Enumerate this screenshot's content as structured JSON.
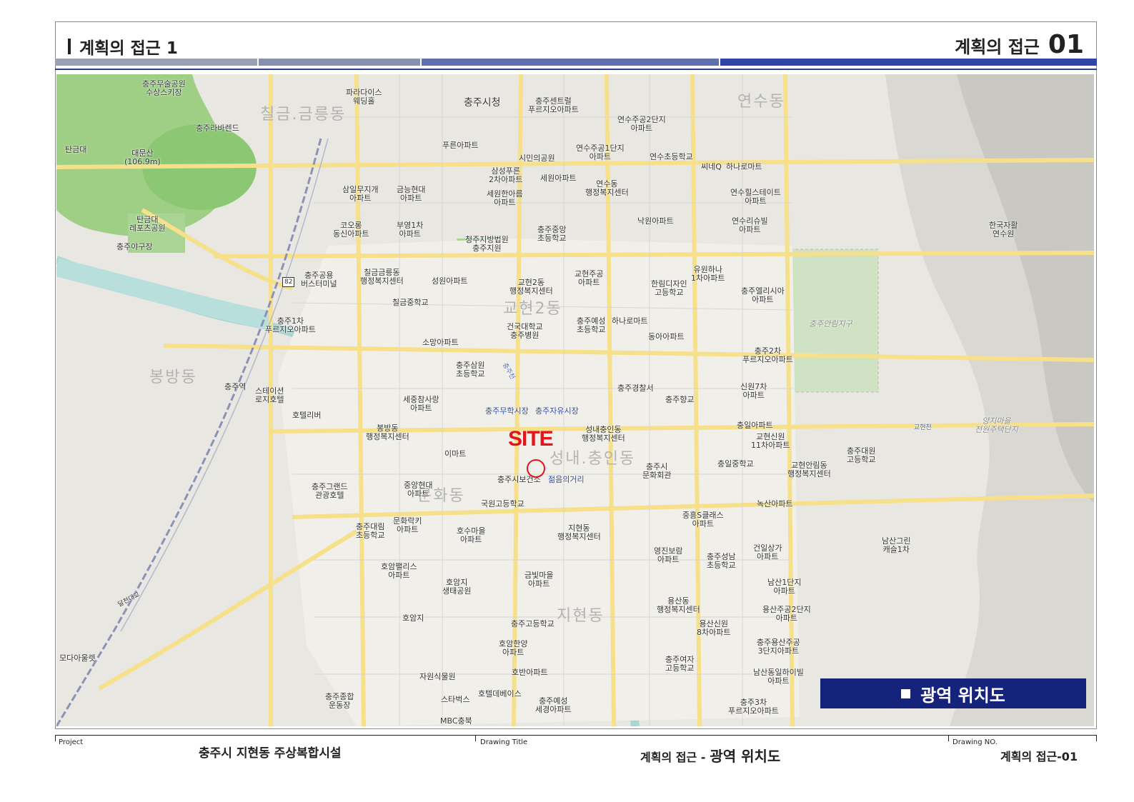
{
  "header": {
    "left_title": "계획의 접근 1",
    "right_title": "계획의 접근",
    "right_number": "01"
  },
  "colors": {
    "stripe_1": "#9aa1b5",
    "stripe_2": "#8790ac",
    "stripe_3": "#5e70ad",
    "stripe_4": "#3046a6",
    "site_red": "#e3141c",
    "legend_navy": "#16237a"
  },
  "map": {
    "site_label": "SITE",
    "legend_label": "광역 위치도",
    "districts": [
      "칠금.금릉동",
      "연수동",
      "교현2동",
      "봉방동",
      "성내.충인동",
      "지현동",
      "문화동"
    ],
    "places": [
      "충주무술공원\n수상스키장",
      "파라다이스\n웨딩홀",
      "충주시청",
      "충주센트럴\n푸르지오아파트",
      "연수주공2단지\n아파트",
      "충주라바렌드",
      "탄금대",
      "대문산\n(106.9m)",
      "푸른아파트",
      "시민의공원",
      "연수주공1단지\n아파트",
      "연수초등학교",
      "씨네Q",
      "하나로마트",
      "삼성푸른\n2차아파트",
      "세원아파트",
      "연수동\n행정복지센터",
      "삼일무지개\n아파트",
      "금능현대\n아파트",
      "세원한아름\n아파트",
      "연수힐스테이트\n아파트",
      "탄금대\n레포츠공원",
      "코오롱\n동신아파트",
      "부영1차\n아파트",
      "충주중앙\n초등학교",
      "낙원아파트",
      "연수리슈빌\n아파트",
      "한국자활\n연수원",
      "충주야구장",
      "청주지방법원\n충주지원",
      "충주공용\n버스터미널",
      "칠금금릉동\n행정복지센터",
      "성원아파트",
      "교현2동\n행정복지센터",
      "교현주공\n아파트",
      "한림디자인\n고등학교",
      "유원하나\n1차아파트",
      "충주엘리시아\n아파트",
      "칠금중학교",
      "충주1차\n푸르지오아파트",
      "건국대학교\n충주병원",
      "충주예성\n초등학교",
      "하나로마트",
      "충주안림지구",
      "동아아파트",
      "소망아파트",
      "충주2차\n푸르지오아파트",
      "충주삼원\n초등학교",
      "충주경찰서",
      "충주역",
      "스테이션\n로지호텔",
      "신원7차\n아파트",
      "세중참사랑\n아파트",
      "충주향교",
      "호텔리버",
      "충주무학시장",
      "충주자유시장",
      "봉방동\n행정복지센터",
      "성내충인동\n행정복지센터",
      "충일아파트",
      "교현신원\n11차아파트",
      "양지마을\n전원주택단지",
      "이마트",
      "충일중학교",
      "교현안림동\n행정복지센터",
      "충주대원\n고등학교",
      "충주시보건소",
      "젊음의거리",
      "충주시\n문화회관",
      "충주그랜드\n관광호텔",
      "중앙현대\n아파트",
      "국원고등학교",
      "녹산아파트",
      "충주대림\n초등학교",
      "문화락키\n아파트",
      "지현동\n행정복지센터",
      "중흥S클래스\n아파트",
      "호수마을\n아파트",
      "남산그린\n캐슬1차",
      "영진보람\n아파트",
      "충주성남\n초등학교",
      "건일상가\n아파트",
      "호암팰리스\n아파트",
      "호암지\n생태공원",
      "금빛마을\n아파트",
      "남산1단지\n아파트",
      "용산동\n행정복지센터",
      "용산주공2단지\n아파트",
      "호암지",
      "충주고등학교",
      "용산신원\n8차아파트",
      "모다아울렛",
      "호암한양\n아파트",
      "충주용산주공\n3단지아파트",
      "충주여자\n고등학교",
      "남산동일하이빌\n아파트",
      "자원식물원",
      "호반아파트",
      "충주종합\n운동장",
      "스타벅스",
      "호텔데베이스",
      "충주예성\n세경아파트",
      "충주3차\n푸르지오아파트",
      "MBC충북",
      "82",
      "달천대교",
      "교현천",
      "충주천"
    ]
  },
  "footer": {
    "project_caption": "Project",
    "project_value": "충주시 지현동 주상복합시설",
    "drawing_title_caption": "Drawing Title",
    "drawing_title_prefix": "계획의 접근 -",
    "drawing_title_value": "광역 위치도",
    "drawing_no_caption": "Drawing NO.",
    "drawing_no_value": "계획의 접근-01"
  }
}
